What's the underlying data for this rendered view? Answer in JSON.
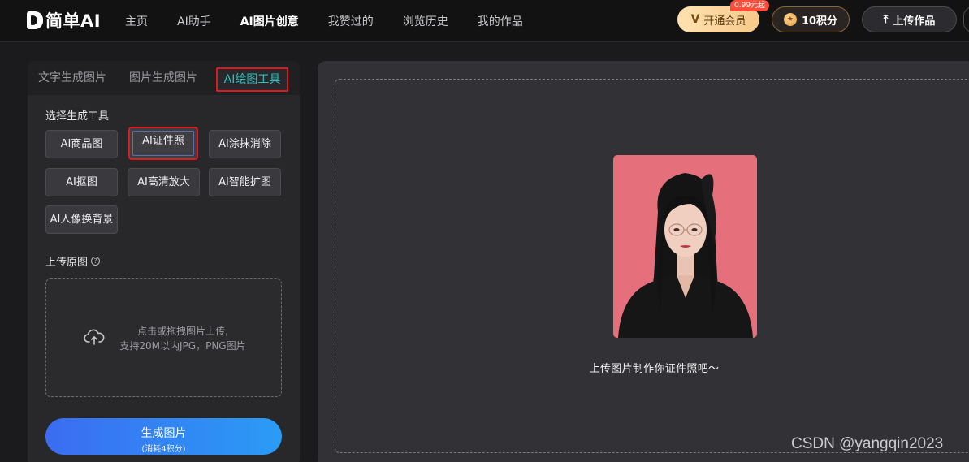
{
  "header": {
    "logo_text": "简单AI",
    "nav": [
      {
        "label": "主页",
        "active": false
      },
      {
        "label": "AI助手",
        "active": false
      },
      {
        "label": "AI图片创意",
        "active": true
      },
      {
        "label": "我赞过的",
        "active": false
      },
      {
        "label": "浏览历史",
        "active": false
      },
      {
        "label": "我的作品",
        "active": false
      }
    ],
    "vip_label": "开通会员",
    "vip_badge": "0.99元起",
    "points_label": "10积分",
    "upload_label": "上传作品"
  },
  "left_panel": {
    "tabs": [
      "文字生成图片",
      "图片生成图片",
      "AI绘图工具"
    ],
    "active_tab": "AI绘图工具",
    "tool_section_title": "选择生成工具",
    "tools": [
      "AI商品图",
      "AI证件照",
      "AI涂抹消除",
      "AI抠图",
      "AI高清放大",
      "AI智能扩图",
      "AI人像换背景"
    ],
    "selected_tool": "AI证件照",
    "upload_section_title": "上传原图",
    "dropzone_line1": "点击或拖拽图片上传,",
    "dropzone_line2": "支持20M以内JPG，PNG图片",
    "generate_label": "生成图片",
    "generate_sub": "(消耗4积分)"
  },
  "preview": {
    "hint": "上传图片制作你证件照吧～"
  },
  "watermark": "CSDN @yangqin2023",
  "colors": {
    "accent_blue": "#3b6cf2",
    "active_tab": "#2bc2c2",
    "highlight_red": "#e0191f",
    "photo_bg": "#e56f7b",
    "vip_gold": "#f6c98a"
  }
}
